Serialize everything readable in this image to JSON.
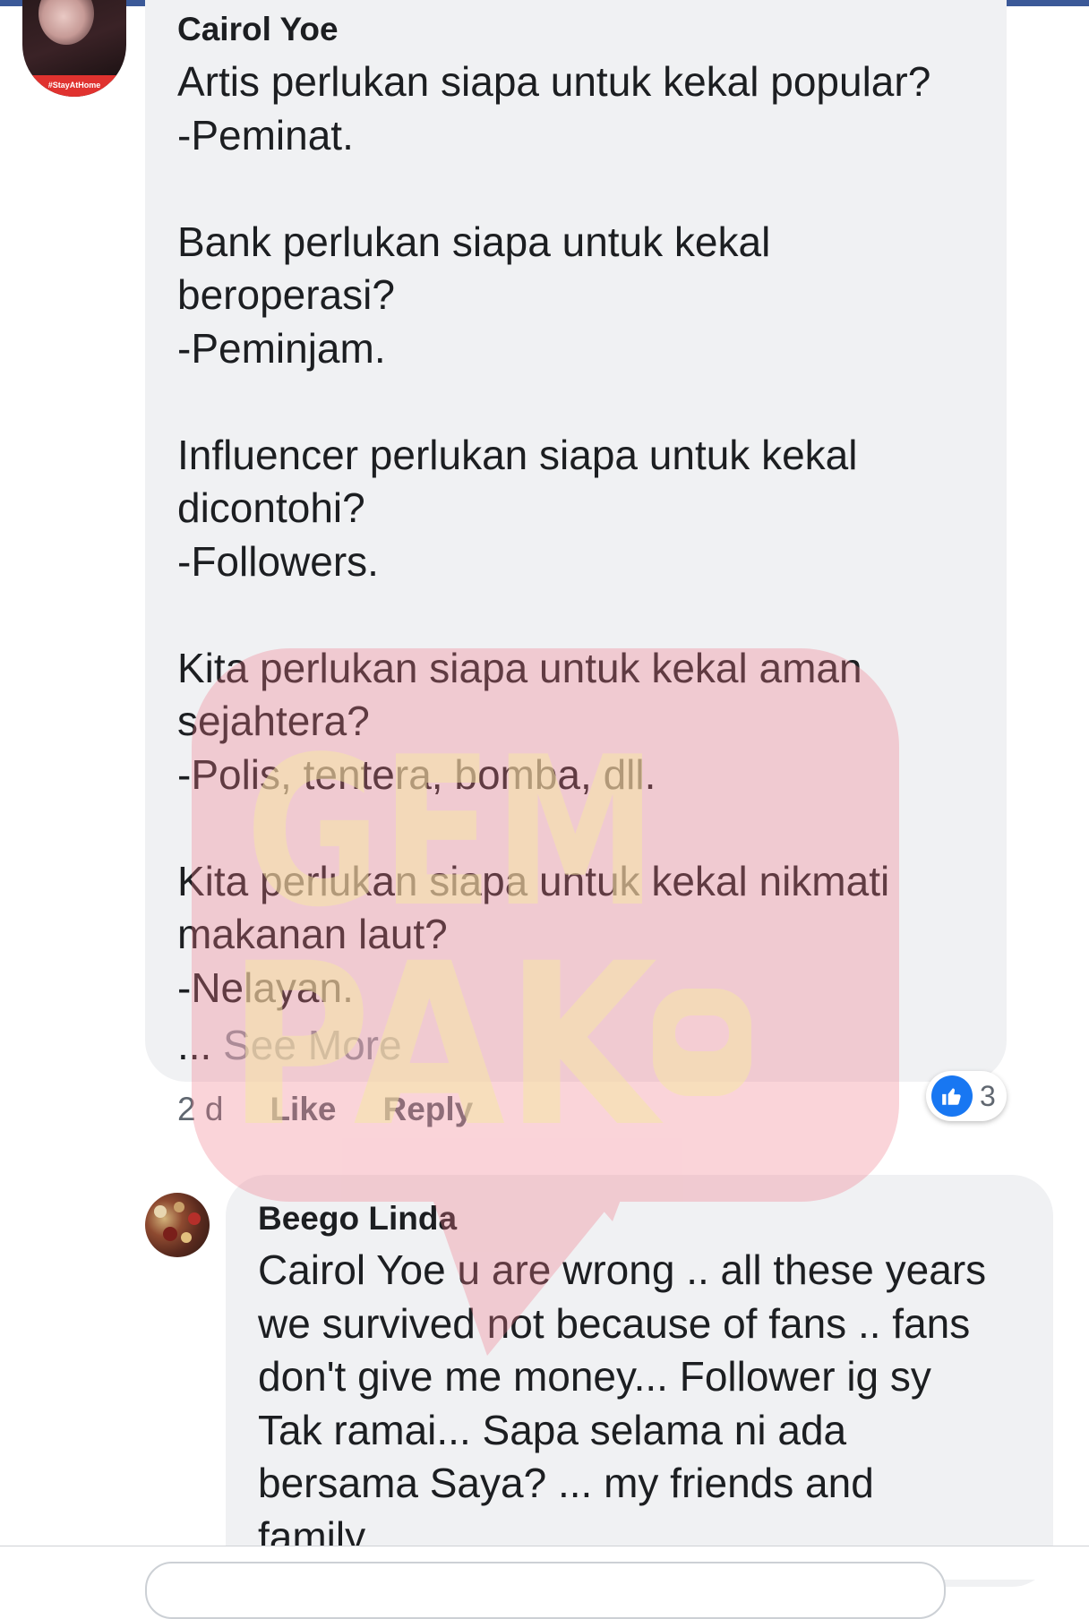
{
  "comment_1": {
    "author": "Cairol Yoe",
    "avatar_banner": "#StayAtHome",
    "body": "Artis perlukan siapa untuk kekal popular?\n-Peminat.\n\nBank perlukan siapa untuk kekal\nberoperasi?\n-Peminjam.\n\nInfluencer perlukan siapa untuk kekal\ndicontohi?\n-Followers.\n\nKita perlukan siapa untuk kekal aman\nsejahtera?\n-Polis, tentera, bomba, dll.\n\nKita perlukan siapa untuk kekal nikmati\nmakanan laut?\n-Nelayan.",
    "ellipsis": "...",
    "see_more": "See More",
    "time": "2 d",
    "like_label": "Like",
    "reply_label": "Reply",
    "reaction_icon": "thumbs-up-icon",
    "reaction_count": "3"
  },
  "comment_2": {
    "author": "Beego Linda",
    "body": "Cairol Yoe u are wrong .. all these years\nwe survived not because of fans .. fans\ndon't give me money... Follower ig sy\nTak ramai... Sapa selama ni ada\nbersama Saya? ... my friends and\nfamily.."
  },
  "watermark": {
    "line_1": "GEM",
    "line_2": "PAK"
  },
  "colors": {
    "top_bar": "#3b5998",
    "bubble": "#f0f1f3",
    "like_blue": "#1877f2",
    "watermark_red": "#f07a8a",
    "watermark_yellow": "#f6e7a6"
  }
}
